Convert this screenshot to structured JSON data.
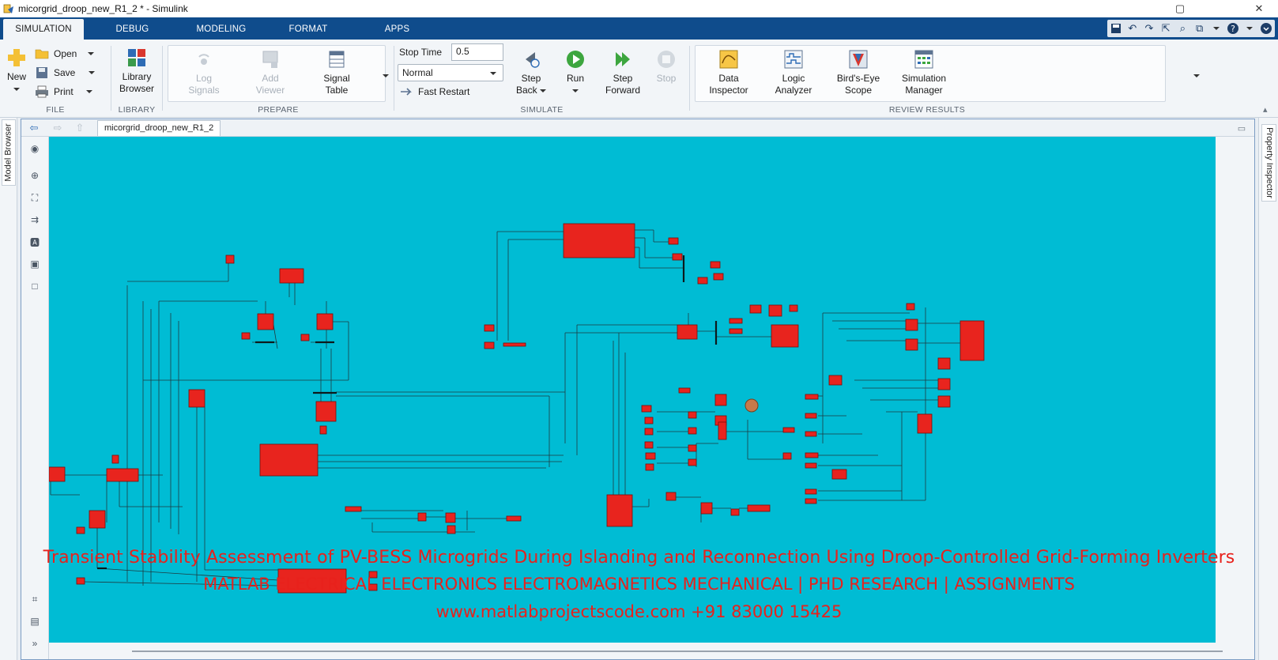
{
  "window": {
    "title": "micorgrid_droop_new_R1_2 * - Simulink",
    "controls": {
      "restore": "▢",
      "close": "✕"
    }
  },
  "tabs": [
    "SIMULATION",
    "DEBUG",
    "MODELING",
    "FORMAT",
    "APPS"
  ],
  "active_tab": "SIMULATION",
  "ribbon": {
    "file": {
      "label": "FILE",
      "new": "New",
      "open": "Open",
      "save": "Save",
      "print": "Print"
    },
    "library": {
      "label": "LIBRARY",
      "browser_line1": "Library",
      "browser_line2": "Browser"
    },
    "prepare": {
      "label": "PREPARE",
      "log1": "Log",
      "log2": "Signals",
      "add1": "Add",
      "add2": "Viewer",
      "table1": "Signal",
      "table2": "Table"
    },
    "simulate": {
      "label": "SIMULATE",
      "stop_time_label": "Stop Time",
      "stop_time_value": "0.5",
      "mode": "Normal",
      "fast_restart": "Fast Restart",
      "step_back1": "Step",
      "step_back2": "Back",
      "run": "Run",
      "step_fwd1": "Step",
      "step_fwd2": "Forward",
      "stop": "Stop"
    },
    "review": {
      "label": "REVIEW RESULTS",
      "di1": "Data",
      "di2": "Inspector",
      "la1": "Logic",
      "la2": "Analyzer",
      "be1": "Bird's-Eye",
      "be2": "Scope",
      "sm1": "Simulation",
      "sm2": "Manager"
    }
  },
  "side_panels": {
    "left": "Model Browser",
    "right": "Property Inspector"
  },
  "model_tab": "micorgrid_droop_new_R1_2",
  "overlay": {
    "line1": "Transient Stability Assessment of PV-BESS Microgrids During Islanding and Reconnection Using Droop-Controlled Grid-Forming Inverters",
    "line2": "MATLAB ELECTRICAL ELECTRONICS ELECTROMAGNETICS MECHANICAL | PHD RESEARCH | ASSIGNMENTS",
    "line3": "www.matlabprojectscode.com +91 83000 15425"
  },
  "colors": {
    "canvas": "#00bcd4",
    "block": "#e8241e",
    "tabstrip": "#0f4c8c",
    "overlay_text": "#e8211c"
  }
}
